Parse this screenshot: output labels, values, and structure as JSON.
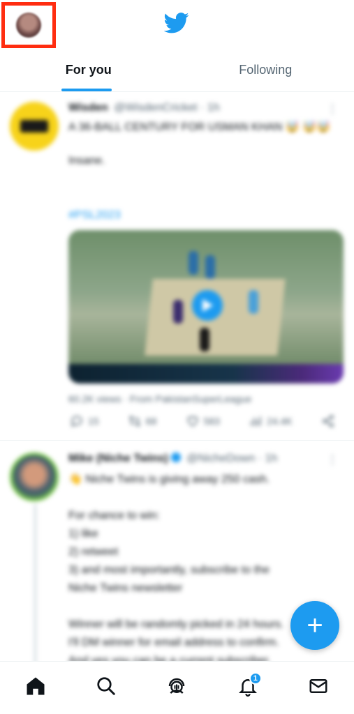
{
  "header": {
    "logo_icon": "twitter-bird-icon",
    "avatar_icon": "profile-avatar",
    "highlight_color": "#ff2d10"
  },
  "tabs": [
    {
      "label": "For you",
      "active": true
    },
    {
      "label": "Following",
      "active": false
    }
  ],
  "accent_color": "#1d9bf0",
  "feed": {
    "tweet1": {
      "name": "Wisden",
      "handle": "@WisdenCricket · 1h",
      "text": "A 36-BALL CENTURY FOR USMAN KHAN 🤯 🤯🤯",
      "text2": "Insane.",
      "hashtag": "#PSL2023",
      "views": "60.2K views · From PakistanSuperLeague",
      "replies": "15",
      "retweets": "68",
      "likes": "583",
      "stats": "24.4K"
    },
    "tweet2": {
      "name": "Mike (Niche Twins)",
      "handle": "@NicheDown · 1h",
      "lines": [
        "👋 Niche Twins is giving away 250 cash.",
        "",
        "For chance to win:",
        "1) like",
        "2) retweet",
        "3) and most importantly, subscribe to the",
        "Niche Twins newsletter",
        "",
        "Winner will be randomly picked in 24 hours.",
        "I'll DM winner for email address to confirm.",
        "And yes you can be a current subscriber."
      ]
    }
  },
  "bottom_nav": {
    "items": [
      "home-icon",
      "search-icon",
      "spaces-icon",
      "notifications-icon",
      "messages-icon"
    ],
    "notifications_badge": "1"
  }
}
